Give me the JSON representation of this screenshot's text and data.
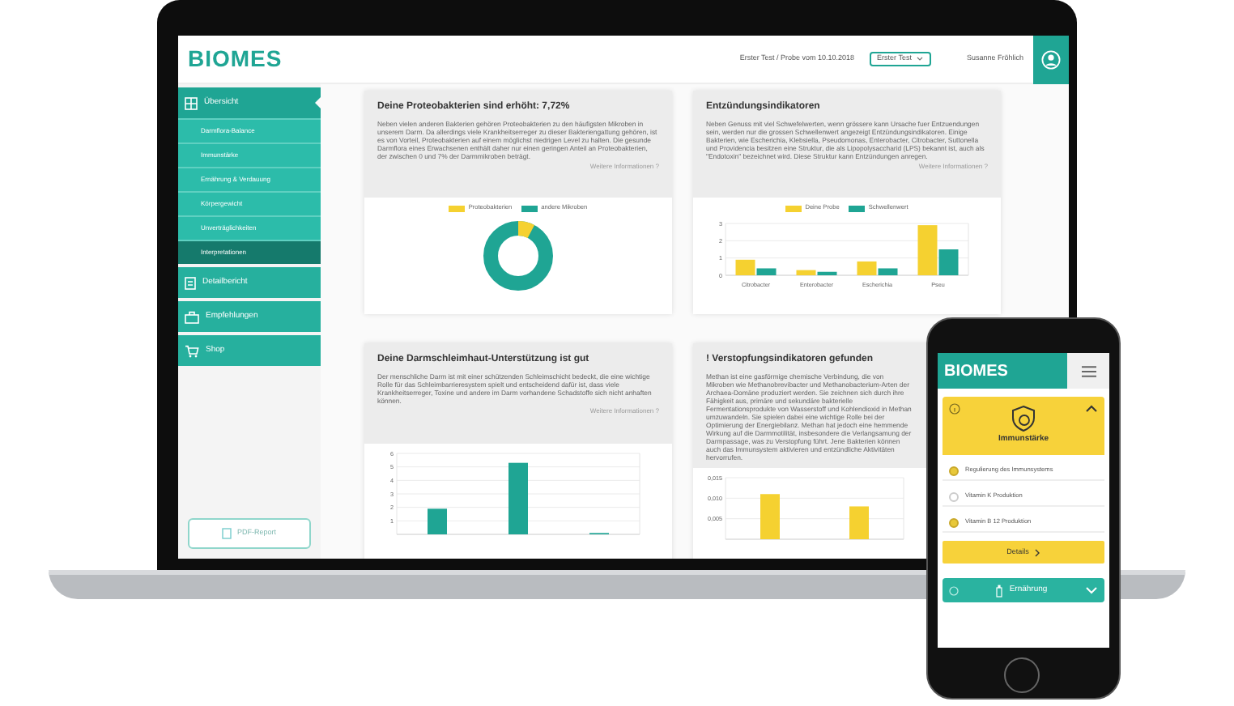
{
  "header": {
    "logo": "BIOMES",
    "test_info": "Erster Test / Probe vom 10.10.2018",
    "test_select": "Erster Test",
    "user": "Susanne Fröhlich"
  },
  "sidebar": {
    "items": [
      {
        "label": "Übersicht",
        "selected": true,
        "children": [
          {
            "label": "Darmflora-Balance",
            "selected": false
          },
          {
            "label": "Immunstärke",
            "selected": false
          },
          {
            "label": "Ernährung & Verdauung",
            "selected": false
          },
          {
            "label": "Körpergewicht",
            "selected": false
          },
          {
            "label": "Unverträglichkeiten",
            "selected": false
          },
          {
            "label": "Interpretationen",
            "selected": true
          }
        ]
      },
      {
        "label": "Detailbericht",
        "selected": false
      },
      {
        "label": "Empfehlungen",
        "selected": false
      },
      {
        "label": "Shop",
        "selected": false
      }
    ],
    "pdf_button": "PDF-Report"
  },
  "cards": [
    {
      "kind": "donut",
      "title": "Deine Proteobakterien sind erhöht: 7,72%",
      "text": "Neben vielen anderen Bakterien gehören Proteobakterien zu den häufigsten Mikroben in unserem Darm. Da allerdings viele Krankheitserreger zu dieser Bakteriengattung gehören, ist es von Vorteil, Proteobakterien auf einem möglichst niedrigen Level zu halten. Die gesunde Darmflora eines Erwachsenen enthält daher nur einen geringen Anteil an Proteobakterien, der zwischen 0 und 7% der Darmmikroben beträgt.",
      "link": "Weitere Informationen ?",
      "legend": [
        {
          "label": "Proteobakterien",
          "color": "#f5d130"
        },
        {
          "label": "andere Mikroben",
          "color": "#1fa594"
        }
      ]
    },
    {
      "kind": "bar",
      "title": "Entzündungsindikatoren",
      "text": "Neben Genuss mit viel Schwefelwerten, wenn grössere kann Ursache fuer Entzuendungen sein, werden nur die grossen Schwellenwert angezeigt Entzündungsindikatoren. Einige Bakterien, wie Escherichia, Klebsiella, Pseudomonas, Enterobacter, Citrobacter, Suttonella und Providencia besitzen eine Struktur, die als Lipopolysaccharid (LPS) bekannt ist, auch als \"Endotoxin\" bezeichnet wird. Diese Struktur kann Entzündungen anregen.",
      "link": "Weitere Informationen ?",
      "chart_data": {
        "type": "bar",
        "categories": [
          "Citrobacter",
          "Enterobacter",
          "Escherichia",
          "Pseu"
        ],
        "series": [
          {
            "name": "Deine Probe",
            "color": "#f5d130",
            "values": [
              0.9,
              0.3,
              0.8,
              2.9
            ]
          },
          {
            "name": "Schwellenwert",
            "color": "#1fa594",
            "values": [
              0.4,
              0.2,
              0.4,
              1.5
            ]
          }
        ],
        "ylim": [
          0,
          3
        ],
        "yticks": [
          0,
          1,
          2,
          3
        ],
        "grid": true
      }
    },
    {
      "kind": "bar",
      "title": "Deine Darmschleimhaut-Unterstützung ist gut",
      "text": "Der menschliche Darm ist mit einer schützenden Schleimschicht bedeckt, die eine wichtige Rolle für das Schleimbarrieresystem spielt und entscheidend dafür ist, dass viele Krankheitserreger, Toxine und andere im Darm vorhandene Schadstoffe sich nicht anhaften können.",
      "link": "Weitere Informationen ?",
      "chart_data": {
        "type": "bar",
        "series": [
          {
            "color": "#1fa594",
            "values": [
              1.9,
              5.3,
              0.1
            ]
          }
        ],
        "ylim": [
          0,
          6
        ],
        "yticks": [
          1,
          2,
          3,
          4,
          5,
          6
        ],
        "grid": true
      }
    },
    {
      "kind": "bar",
      "title": "! Verstopfungsindikatoren gefunden",
      "text": "Methan ist eine gasförmige chemische Verbindung, die von Mikroben wie Methanobrevibacter und Methanobacterium-Arten der Archaea-Domäne produziert werden. Sie zeichnen sich durch ihre Fähigkeit aus, primäre und sekundäre bakterielle Fermentationsprodukte von Wasserstoff und Kohlendioxid in Methan umzuwandeln. Sie spielen dabei eine wichtige Rolle bei der Optimierung der Energiebilanz. Methan hat jedoch eine hemmende Wirkung auf die Darmmotilität, insbesondere die Verlangsamung der Darmpassage, was zu Verstopfung führt. Jene Bakterien können auch das Immunsystem aktivieren und entzündliche Aktivitäten hervorrufen.",
      "chart_data": {
        "type": "bar",
        "series": [
          {
            "color": "#f5d130",
            "values": [
              0.011,
              0.008
            ]
          }
        ],
        "ylim": [
          0,
          0.015
        ],
        "yticks": [
          {
            "value": 0.005,
            "label": "0,005"
          },
          {
            "value": 0.01,
            "label": "0,010"
          },
          {
            "value": 0.015,
            "label": "0,015"
          }
        ],
        "grid": true
      }
    }
  ],
  "phone": {
    "logo": "BIOMES",
    "sections": [
      {
        "title": "Immunstärke",
        "expanded": true,
        "items": [
          {
            "label": "Regulierung des Immunsystems",
            "checked": true
          },
          {
            "label": "Vitamin K Produktion",
            "checked": false
          },
          {
            "label": "Vitamin B 12 Produktion",
            "checked": true
          }
        ],
        "button": "Details"
      },
      {
        "title": "Ernährung",
        "expanded": false
      }
    ]
  }
}
